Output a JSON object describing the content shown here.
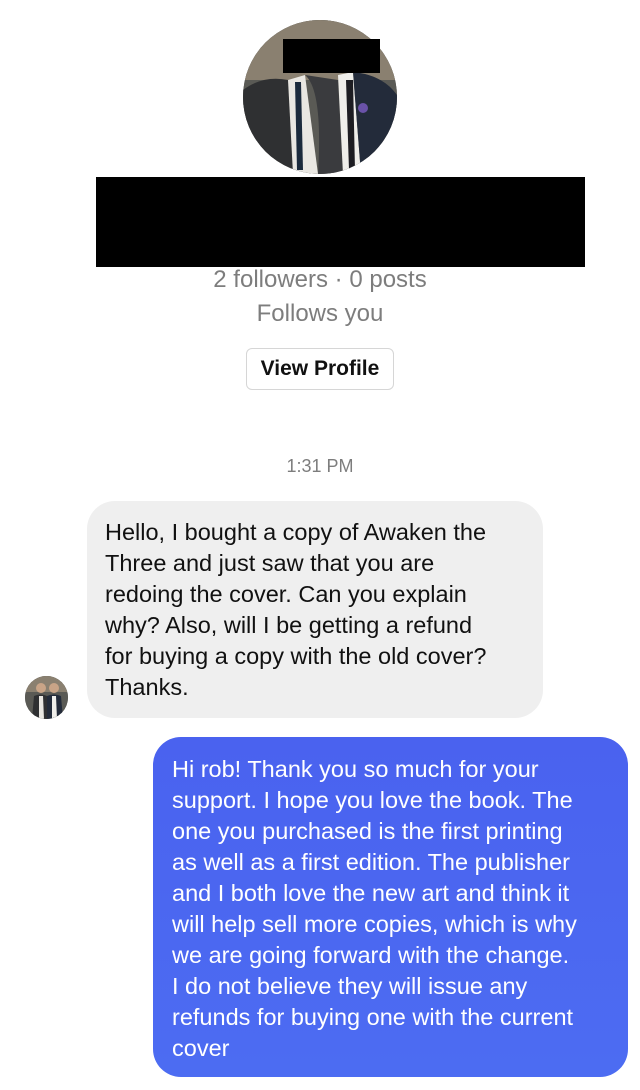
{
  "profile": {
    "stats": "2 followers · 0 posts",
    "follows_status": "Follows you",
    "view_profile_label": "View Profile"
  },
  "thread": {
    "timestamp": "1:31 PM",
    "messages": [
      {
        "sender": "other",
        "text": "Hello, I bought a copy of Awaken the\nThree and just saw that you are\nredoing the cover. Can you explain\nwhy? Also, will I be getting a refund\nfor buying a copy with the old cover?\nThanks."
      },
      {
        "sender": "me",
        "text": "Hi rob! Thank you so much for your\nsupport. I hope you love the book. The\none you purchased is the first printing\nas well as a first edition. The publisher\nand I both love the new art and think it\nwill help sell more copies, which is why\nwe are going forward with the change.\nI do not believe they will issue any\nrefunds for buying one with the current\ncover"
      }
    ]
  },
  "colors": {
    "incoming_bubble": "#efefef",
    "outgoing_bubble": "#4a66f0",
    "muted_text": "#7d7d7d"
  }
}
